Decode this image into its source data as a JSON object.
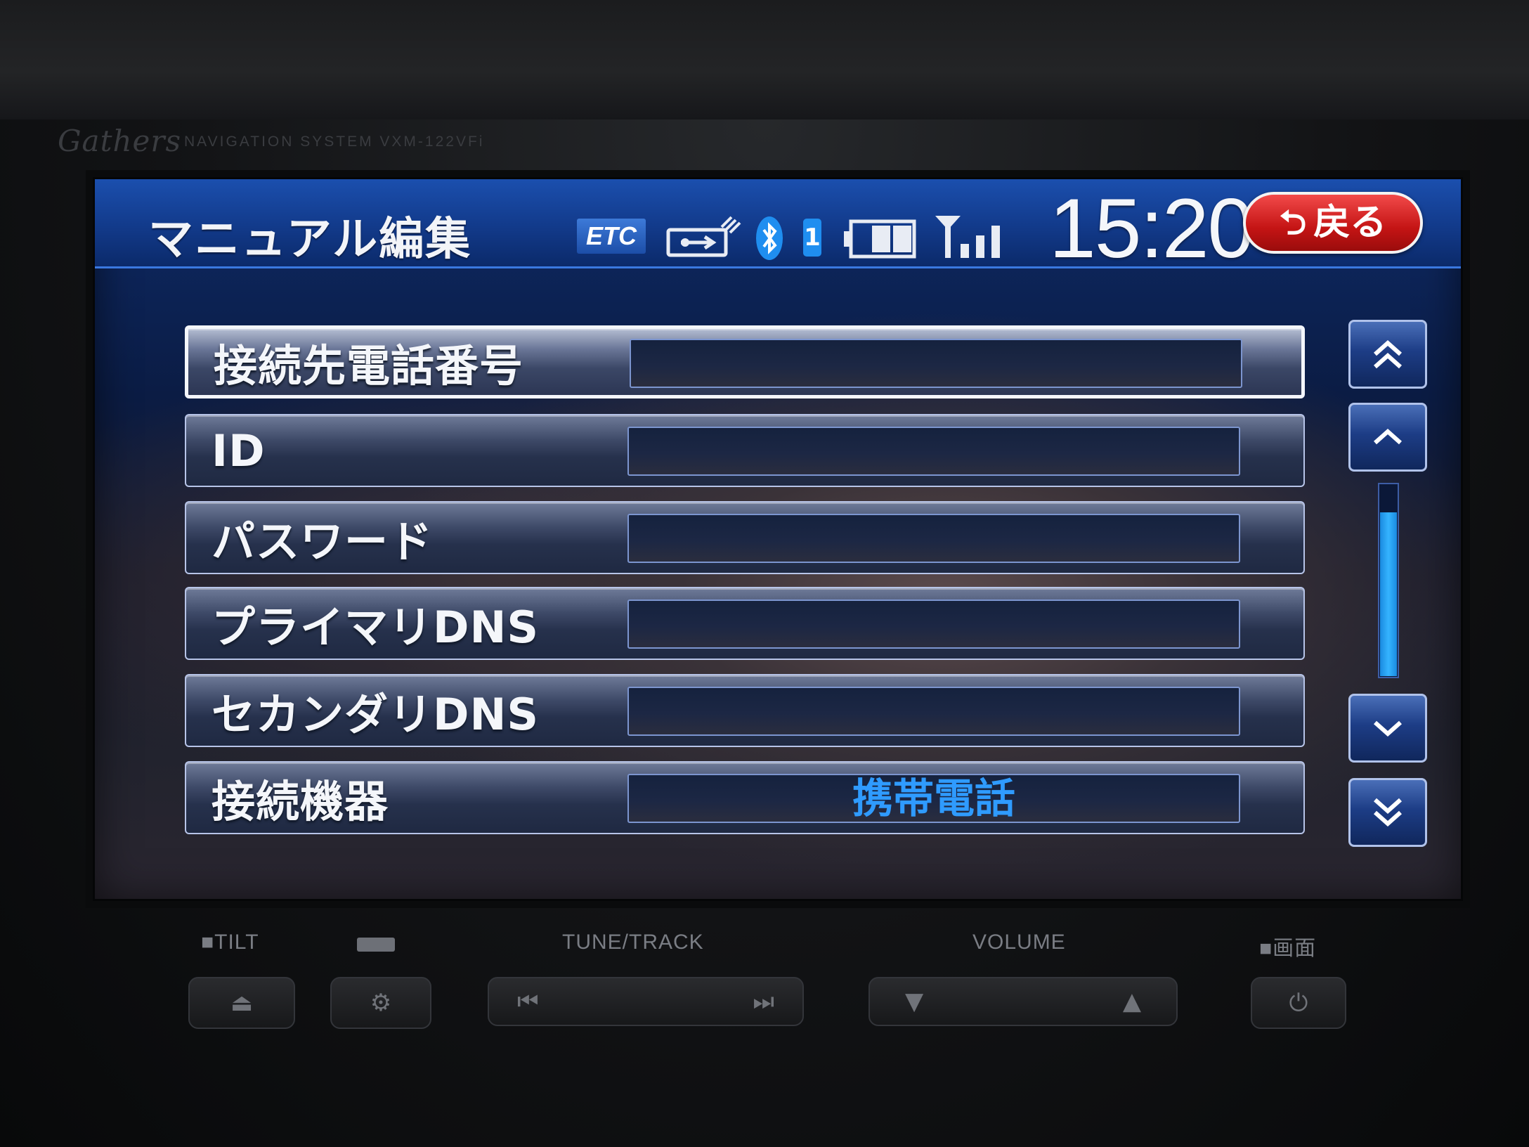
{
  "device": {
    "brand": "Gathers",
    "model_text": "NAVIGATION SYSTEM   VXM-122VFi"
  },
  "header": {
    "title": "マニュアル編集",
    "etc_badge": "ETC",
    "bluetooth_badge": "1",
    "time": "15:20",
    "back_label": "戻る"
  },
  "rows": [
    {
      "label": "接続先電話番号",
      "value": ""
    },
    {
      "label": "ID",
      "value": ""
    },
    {
      "label": "パスワード",
      "value": ""
    },
    {
      "label": "プライマリDNS",
      "value": ""
    },
    {
      "label": "セカンダリDNS",
      "value": ""
    },
    {
      "label": "接続機器",
      "value": "携帯電話"
    }
  ],
  "selected_row": 0,
  "scroll_position": 0.0,
  "panel": {
    "tilt": "■TILT",
    "tune_track": "TUNE/TRACK",
    "volume": "VOLUME",
    "screen": "■画面"
  },
  "colors": {
    "header_blue": "#123a8a",
    "back_red": "#c41414",
    "value_blue": "#2f9bff"
  }
}
